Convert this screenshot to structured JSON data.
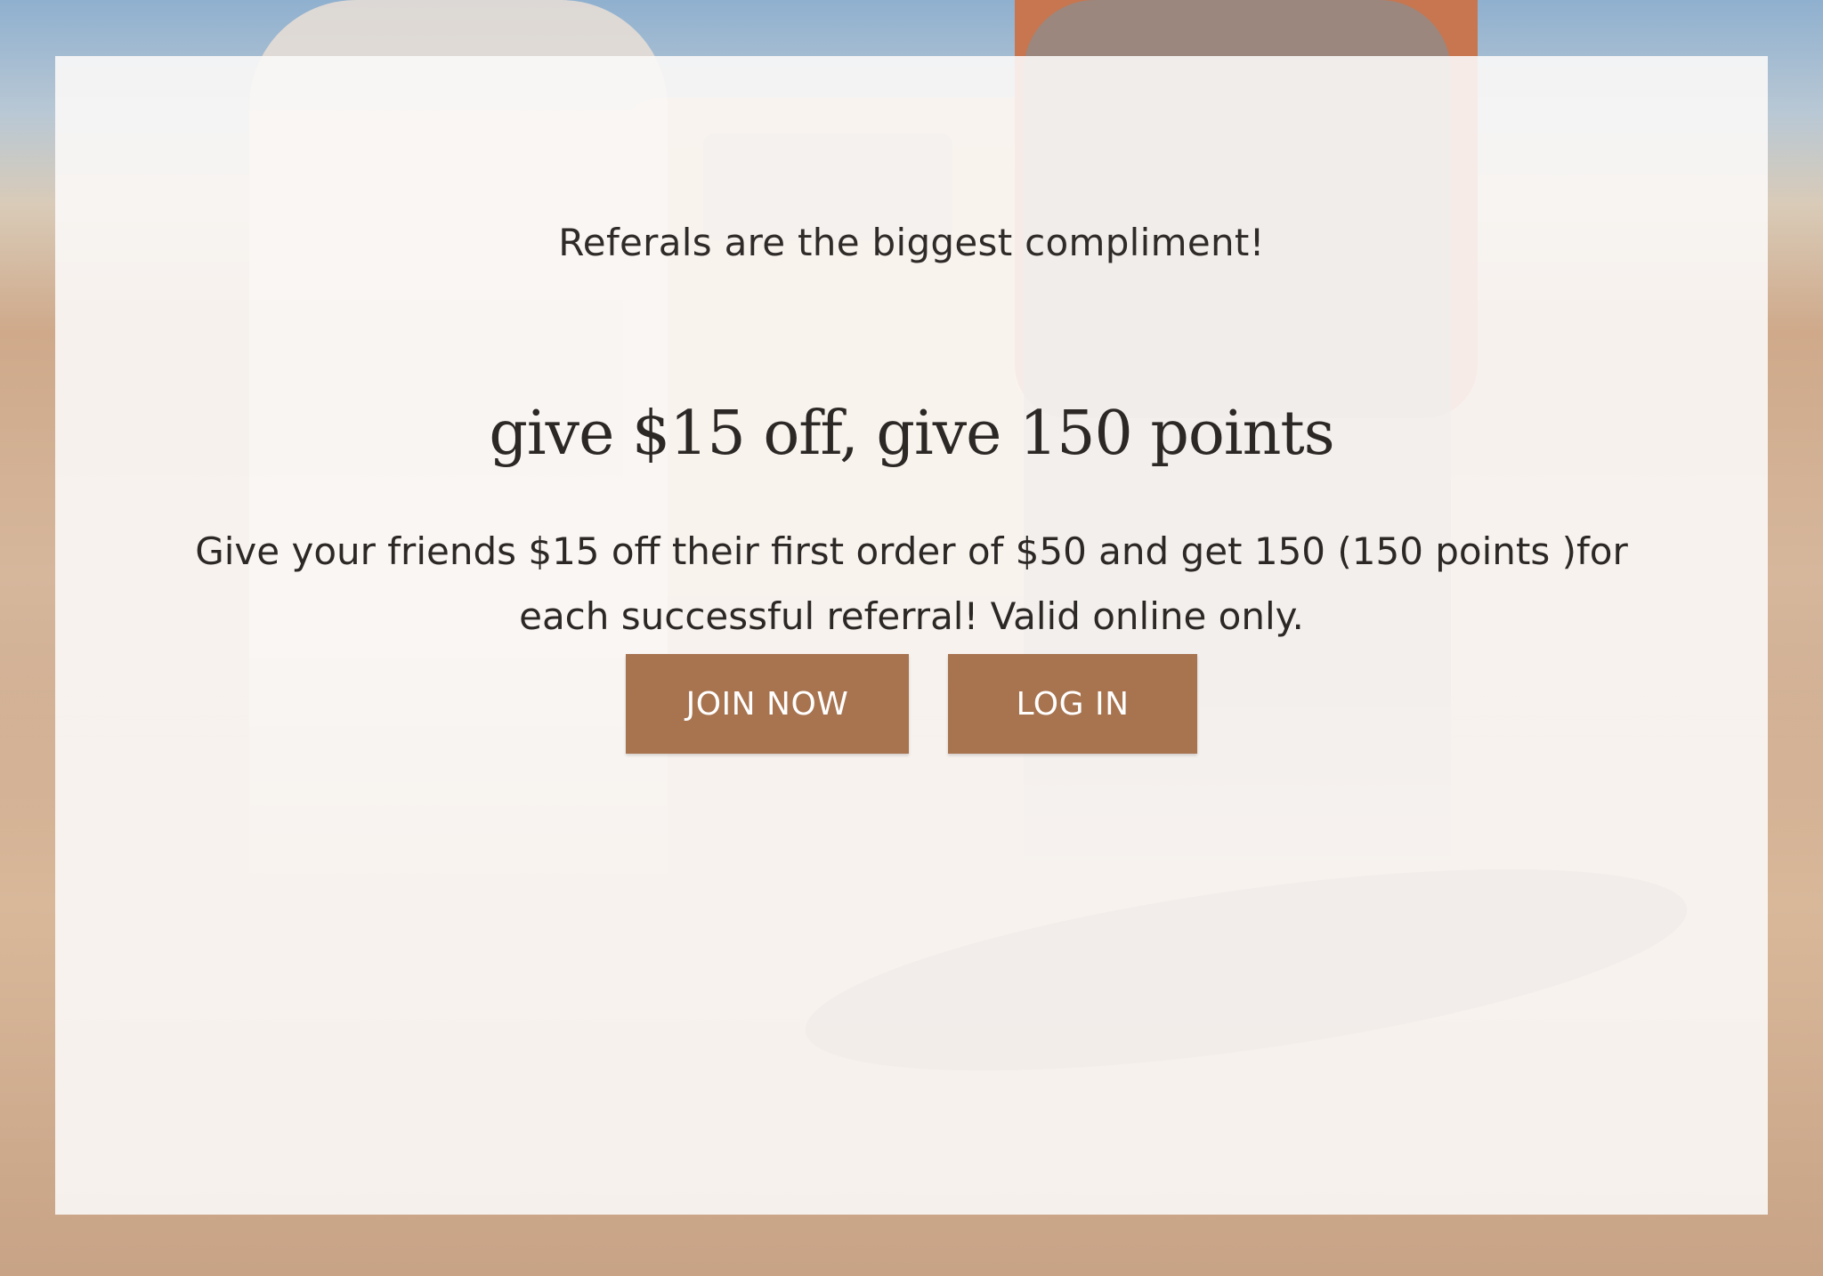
{
  "referral": {
    "subtitle": "Referals are the biggest compliment!",
    "headline": "give $15 off, give 150 points",
    "description": "Give your friends $15 off their first order of $50 and get 150 (150 points )for each successful referral! Valid online only.",
    "buttons": {
      "join_label": "JOIN NOW",
      "login_label": "LOG IN"
    }
  },
  "colors": {
    "button_bg": "#a8734f",
    "button_text": "#ffffff",
    "text": "#2c2826",
    "panel_bg": "#fbf8f7"
  }
}
